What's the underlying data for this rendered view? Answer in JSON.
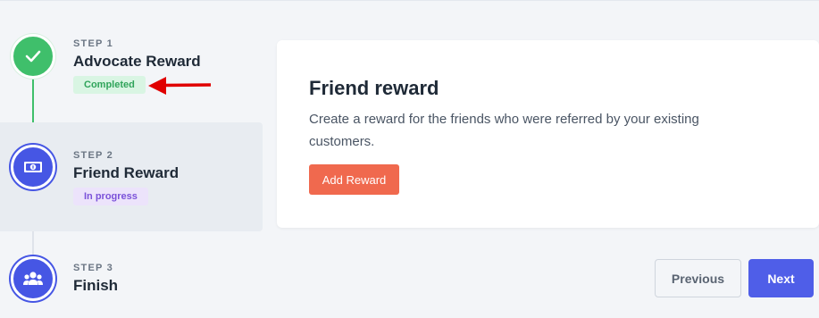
{
  "steps": [
    {
      "label": "STEP 1",
      "title": "Advocate Reward",
      "status": "Completed",
      "icon": "check-icon"
    },
    {
      "label": "STEP 2",
      "title": "Friend Reward",
      "status": "In progress",
      "icon": "money-bill-icon"
    },
    {
      "label": "STEP 3",
      "title": "Finish",
      "icon": "users-icon"
    }
  ],
  "card": {
    "title": "Friend reward",
    "description": "Create a reward for the friends who were referred by your existing customers.",
    "add_button": "Add Reward"
  },
  "footer": {
    "previous": "Previous",
    "next": "Next"
  },
  "colors": {
    "completed": "#3fbf6b",
    "active": "#4656e4",
    "add_button": "#f0694e",
    "next_button": "#4f5ee8",
    "annotation_arrow": "#e00000"
  }
}
